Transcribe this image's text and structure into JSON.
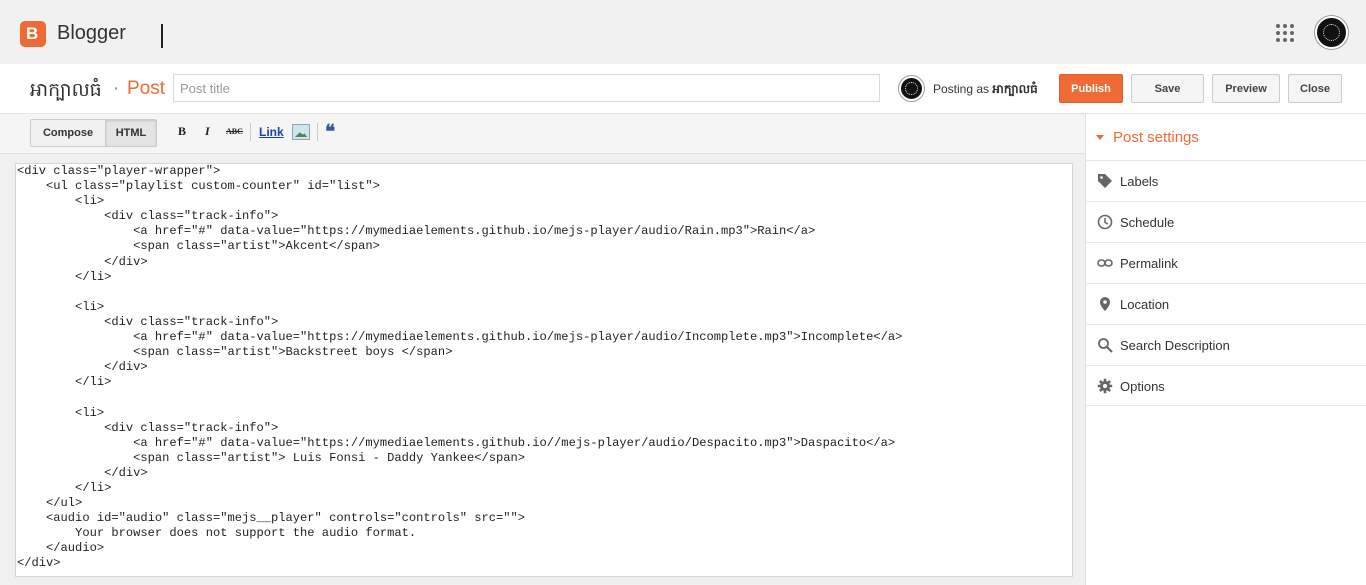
{
  "app": {
    "name": "Blogger"
  },
  "header": {
    "blog_name": "អាក្បាលធំ",
    "separator": "·",
    "section": "Post",
    "title_placeholder": "Post title",
    "posting_as_prefix": "Posting as",
    "posting_as_name": "អាក្បាលធំ"
  },
  "buttons": {
    "publish": "Publish",
    "save": "Save",
    "preview": "Preview",
    "close": "Close"
  },
  "toolbar": {
    "compose": "Compose",
    "html": "HTML",
    "bold": "B",
    "italic": "I",
    "strike": "ABC",
    "link": "Link",
    "quote": "❝"
  },
  "editor": {
    "lines": [
      "<div class=\"player-wrapper\">",
      "    <ul class=\"playlist custom-counter\" id=\"list\">",
      "        <li>",
      "            <div class=\"track-info\">",
      "                <a href=\"#\" data-value=\"https://mymediaelements.github.io/mejs-player/audio/Rain.mp3\">Rain</a>",
      "                <span class=\"artist\">Akcent</span>",
      "            </div>",
      "        </li>",
      "",
      "        <li>",
      "            <div class=\"track-info\">",
      "                <a href=\"#\" data-value=\"https://mymediaelements.github.io/mejs-player/audio/Incomplete.mp3\">Incomplete</a>",
      "                <span class=\"artist\">Backstreet boys </span>",
      "            </div>",
      "        </li>",
      "",
      "        <li>",
      "            <div class=\"track-info\">",
      "                <a href=\"#\" data-value=\"https://mymediaelements.github.io//mejs-player/audio/Despacito.mp3\">Daspacito</a>",
      "                <span class=\"artist\"> Luis Fonsi - Daddy Yankee</span>",
      "            </div>",
      "        </li>",
      "    </ul>",
      "    <audio id=\"audio\" class=\"mejs__player\" controls=\"controls\" src=\"\">",
      "        Your browser does not support the audio format.",
      "    </audio>",
      "</div>"
    ]
  },
  "post_settings": {
    "title": "Post settings",
    "items": [
      {
        "label": "Labels",
        "icon": "tag-icon"
      },
      {
        "label": "Schedule",
        "icon": "clock-icon"
      },
      {
        "label": "Permalink",
        "icon": "link-icon"
      },
      {
        "label": "Location",
        "icon": "location-pin-icon"
      },
      {
        "label": "Search Description",
        "icon": "search-icon"
      },
      {
        "label": "Options",
        "icon": "gear-icon"
      }
    ]
  },
  "colors": {
    "accent": "#f06a35",
    "link": "#1a3fb0",
    "quote": "#3b5b9c"
  }
}
